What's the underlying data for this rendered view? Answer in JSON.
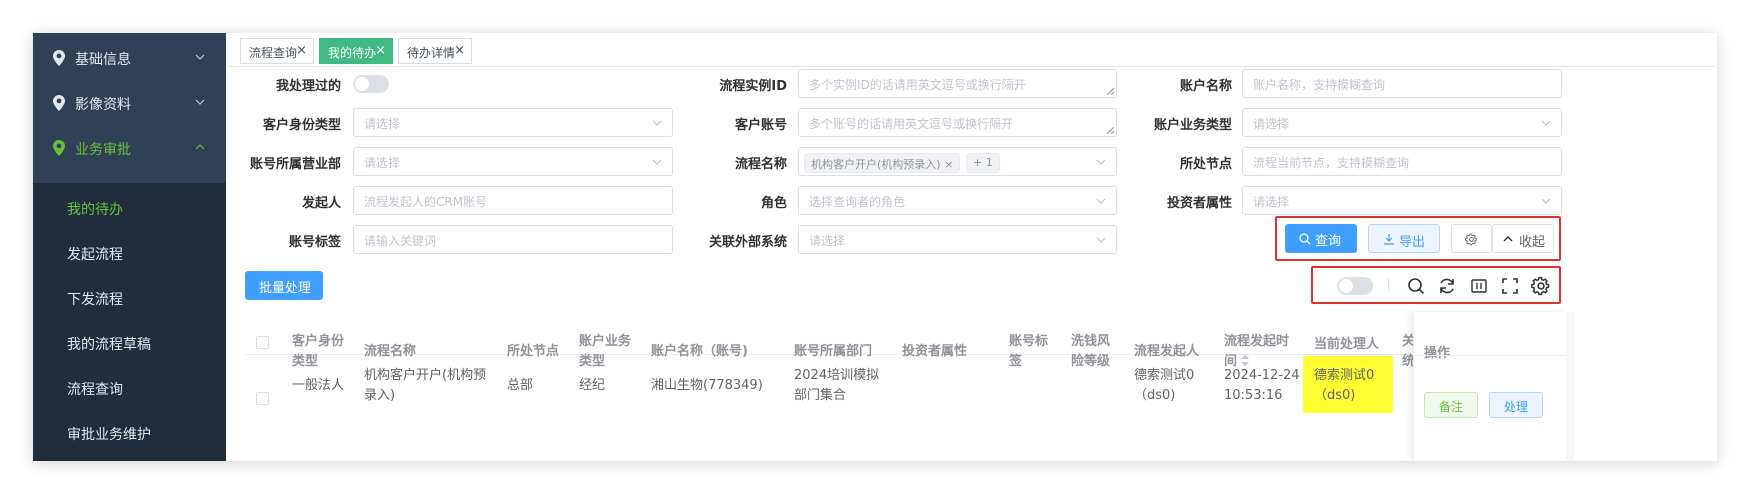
{
  "sidebar": {
    "groups": [
      {
        "label": "基础信息"
      },
      {
        "label": "影像资料"
      },
      {
        "label": "业务审批"
      }
    ],
    "items": [
      {
        "label": "我的待办"
      },
      {
        "label": "发起流程"
      },
      {
        "label": "下发流程"
      },
      {
        "label": "我的流程草稿"
      },
      {
        "label": "流程查询"
      },
      {
        "label": "审批业务维护"
      }
    ]
  },
  "tabs": [
    {
      "label": "流程查询",
      "close": "×"
    },
    {
      "label": "我的待办",
      "close": "×"
    },
    {
      "label": "待办详情",
      "close": "×"
    }
  ],
  "filters": {
    "processed_label": "我处理过的",
    "instance_id": {
      "label": "流程实例ID",
      "placeholder": "多个实例ID的话请用英文逗号或换行隔开"
    },
    "account_name": {
      "label": "账户名称",
      "placeholder": "账户名称，支持模糊查询"
    },
    "cust_identity": {
      "label": "客户身份类型",
      "placeholder": "请选择"
    },
    "cust_account": {
      "label": "客户账号",
      "placeholder": "多个账号的话请用英文逗号或换行隔开"
    },
    "acct_biz_type": {
      "label": "账户业务类型",
      "placeholder": "请选择"
    },
    "acct_dept": {
      "label": "账号所属营业部",
      "placeholder": "请选择"
    },
    "flow_name": {
      "label": "流程名称",
      "tag": "机构客户开户(机构预录入)",
      "tag_close": "×",
      "more": "+ 1"
    },
    "node": {
      "label": "所处节点",
      "placeholder": "流程当前节点，支持模糊查询"
    },
    "initiator": {
      "label": "发起人",
      "placeholder": "流程发起人的CRM账号"
    },
    "role": {
      "label": "角色",
      "placeholder": "选择查询者的角色"
    },
    "investor_attr": {
      "label": "投资者属性",
      "placeholder": "请选择"
    },
    "acct_tag": {
      "label": "账号标签",
      "placeholder": "请输入关键词"
    },
    "ext_system": {
      "label": "关联外部系统",
      "placeholder": "请选择"
    }
  },
  "actions": {
    "query": "查询",
    "export": "导出",
    "collapse": "收起",
    "batch": "批量处理"
  },
  "table": {
    "headers": [
      [
        "客户身份",
        "类型"
      ],
      [
        "流程名称"
      ],
      [
        "所处节点"
      ],
      [
        "账户业务",
        "类型"
      ],
      [
        "账户名称（账号)"
      ],
      [
        "账号所属部门"
      ],
      [
        "投资者属性"
      ],
      [
        "账号标",
        "签"
      ],
      [
        "洗钱风",
        "险等级"
      ],
      [
        "流程发起人"
      ],
      [
        "流程发起时",
        "间"
      ],
      [
        "当前处理人"
      ],
      [
        "关",
        "统"
      ],
      [
        "操作"
      ]
    ],
    "row": {
      "identity": "一般法人",
      "flow_name": [
        "机构客户开户(机构预",
        "录入)"
      ],
      "node": "总部",
      "biz_type": "经纪",
      "account": "湘山生物(778349)",
      "dept": [
        "2024培训模拟",
        "部门集合"
      ],
      "initiator": [
        "德索测试0",
        "（ds0)"
      ],
      "time": [
        "2024-12-24",
        "10:53:16"
      ],
      "handler": [
        "德索测试0",
        "（ds0)"
      ],
      "note_btn": "备注",
      "handle_btn": "处理"
    }
  },
  "colors": {
    "sidebar_bg": "#304156",
    "submenu_bg": "#1f2d3d",
    "active_green": "#67c23a",
    "tab_active": "#42b983",
    "primary": "#409eff",
    "highlight": "#ffff33",
    "annotation_red": "#e0322f"
  }
}
